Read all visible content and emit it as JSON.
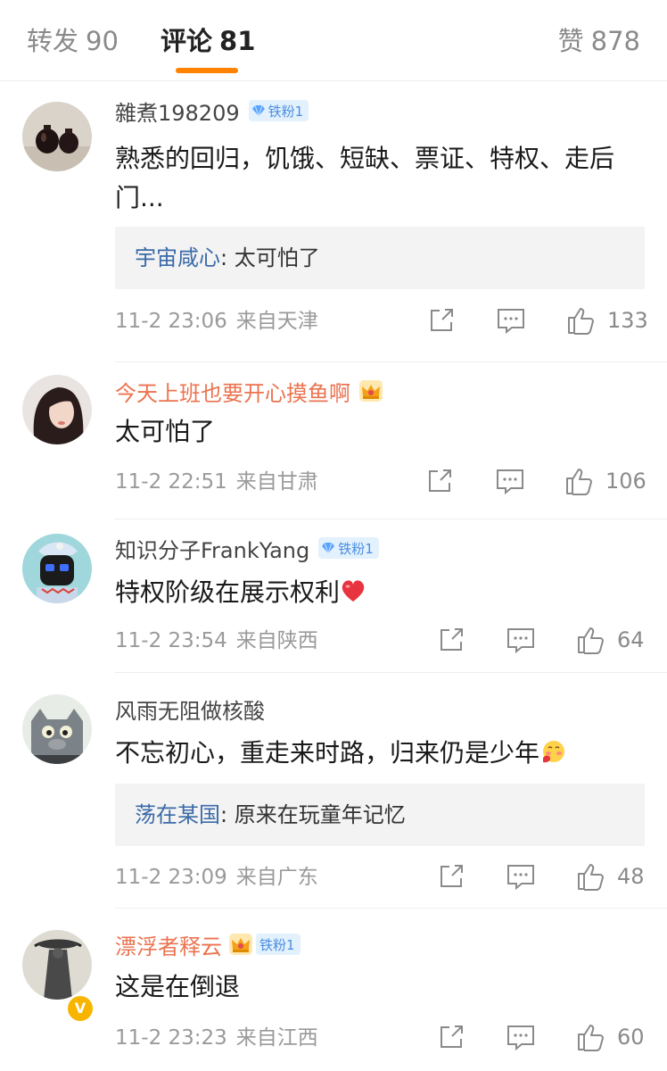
{
  "tabs": {
    "reposts": {
      "label": "转发",
      "count": "90"
    },
    "comments": {
      "label": "评论",
      "count": "81"
    },
    "likes": {
      "label": "赞",
      "count": "878"
    }
  },
  "accent_color": "#ff8200",
  "comments": [
    {
      "username": "雜煮198209",
      "fan_badge": "铁粉1",
      "text": "熟悉的回归，饥饿、短缺、票证、特权、走后门...",
      "reply": {
        "user": "宇宙咸心",
        "text": ": 太可怕了"
      },
      "time": "11-2 23:06",
      "location": "来自天津",
      "likes": "133",
      "avatar_icon": "jar-avatar-icon"
    },
    {
      "username": "今天上班也要开心摸鱼啊",
      "badge_icon": "crown-icon",
      "text": "太可怕了",
      "time": "11-2 22:51",
      "location": "来自甘肃",
      "likes": "106",
      "avatar_icon": "girl-avatar-icon"
    },
    {
      "username": "知识分子FrankYang",
      "fan_badge": "铁粉1",
      "text": "特权阶级在展示权利",
      "text_emoji": "red-heart-icon",
      "time": "11-2 23:54",
      "location": "来自陕西",
      "likes": "64",
      "avatar_icon": "cartoon-avatar-icon"
    },
    {
      "username": "风雨无阻做核酸",
      "text": "不忘初心，重走来时路，归来仍是少年",
      "text_emoji": "blushing-face-icon",
      "reply": {
        "user": "荡在某国",
        "text": ": 原来在玩童年记忆"
      },
      "time": "11-2 23:09",
      "location": "来自广东",
      "likes": "48",
      "avatar_icon": "cat-avatar-icon"
    },
    {
      "username": "漂浮者释云",
      "fan_badge": "铁粉1",
      "badge_icon": "crown-icon",
      "verified": "V",
      "text": "这是在倒退",
      "time": "11-2 23:23",
      "location": "来自江西",
      "likes": "60",
      "avatar_icon": "monk-avatar-icon"
    }
  ]
}
